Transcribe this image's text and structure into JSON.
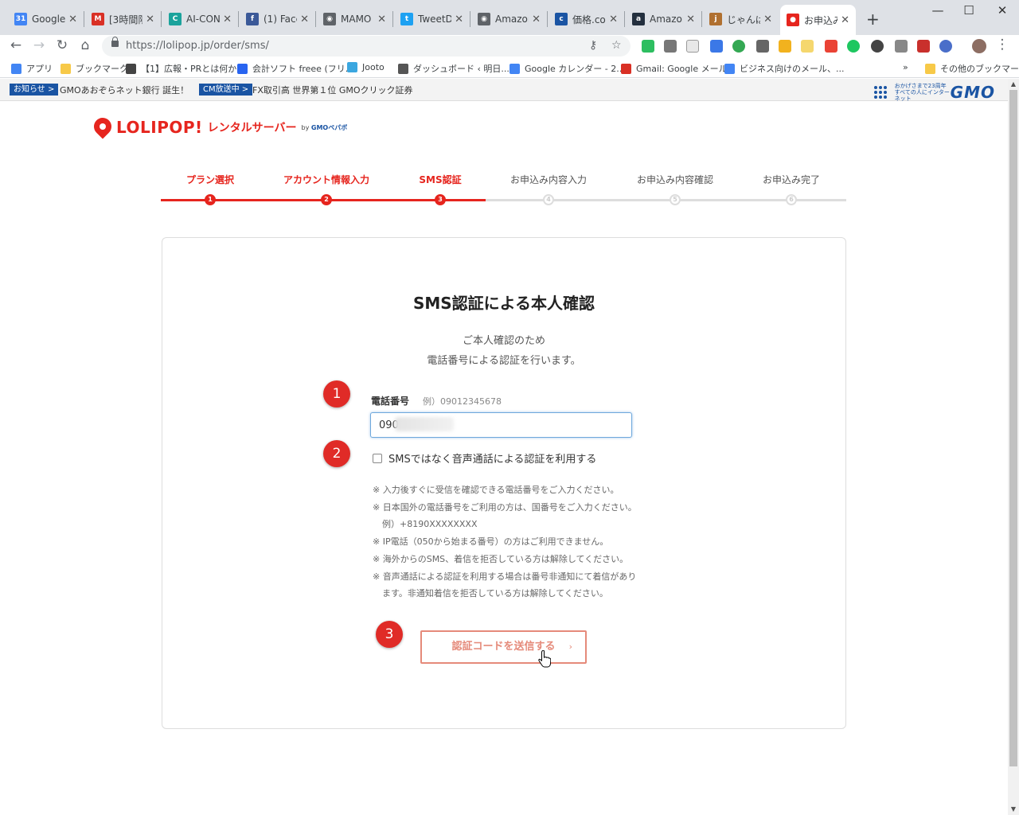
{
  "browser": {
    "tabs": [
      {
        "title": "Google",
        "favicon": "google-calendar-icon",
        "color": "#4285f4",
        "glyph": "31"
      },
      {
        "title": "[3時間限",
        "favicon": "gmail-icon",
        "color": "#d93025",
        "glyph": "M"
      },
      {
        "title": "AI-CON",
        "favicon": "ai-con-icon",
        "color": "#1ba39c",
        "glyph": "C"
      },
      {
        "title": "(1) Face",
        "favicon": "facebook-icon",
        "color": "#3b5998",
        "glyph": "f"
      },
      {
        "title": "MAMO",
        "favicon": "globe-icon",
        "color": "#5f6368",
        "glyph": "◉"
      },
      {
        "title": "TweetD",
        "favicon": "twitter-icon",
        "color": "#1da1f2",
        "glyph": "t"
      },
      {
        "title": "Amazon",
        "favicon": "globe-icon",
        "color": "#5f6368",
        "glyph": "◉"
      },
      {
        "title": "価格.co",
        "favicon": "kakaku-icon",
        "color": "#1a54a3",
        "glyph": "c"
      },
      {
        "title": "Amazon",
        "favicon": "amazon-icon",
        "color": "#232f3e",
        "glyph": "a"
      },
      {
        "title": "じゃんぱ",
        "favicon": "janpara-icon",
        "color": "#b07030",
        "glyph": "j"
      },
      {
        "title": "お申込み",
        "favicon": "lolipop-icon",
        "color": "#e6251e",
        "glyph": "●",
        "active": true
      }
    ],
    "url": "https://lolipop.jp/order/sms/",
    "bookmarks": [
      {
        "label": "アプリ",
        "icon": "apps-icon",
        "color": "#4285f4"
      },
      {
        "label": "ブックマーク",
        "icon": "folder-icon",
        "color": "#f7c948"
      },
      {
        "label": "【1】広報・PRとは何か...",
        "icon": "graduation-icon",
        "color": "#444"
      },
      {
        "label": "会計ソフト freee (フリ...",
        "icon": "freee-icon",
        "color": "#2864f0"
      },
      {
        "label": "Jooto",
        "icon": "jooto-icon",
        "color": "#3ba7e0"
      },
      {
        "label": "ダッシュボード ‹ 明日...",
        "icon": "wordpress-icon",
        "color": "#555"
      },
      {
        "label": "Google カレンダー - 2...",
        "icon": "google-calendar-icon",
        "color": "#4285f4"
      },
      {
        "label": "Gmail: Google メール",
        "icon": "gmail-icon",
        "color": "#d93025"
      },
      {
        "label": "ビジネス向けのメール、...",
        "icon": "google-icon",
        "color": "#4285f4"
      }
    ],
    "bookmarks_overflow": "»",
    "other_bookmarks": "その他のブックマーク"
  },
  "newsbar": {
    "badge1": "お知らせ >",
    "text1": "GMOあおぞらネット銀行 誕生！",
    "badge2": "CM放送中 >",
    "text2": "FX取引高 世界第１位 GMOクリック証券",
    "tagline1": "おかげさまで23周年",
    "tagline2": "すべての人にインターネット",
    "brand": "GMO",
    "accent": "#1a54a3"
  },
  "logo": {
    "name": "LOLIPOP!",
    "sub": "レンタルサーバー",
    "by": "by",
    "by_brand": "GMOペパボ",
    "color": "#e6251e"
  },
  "steps": {
    "items": [
      {
        "label": "プラン選択",
        "num": "1",
        "done": true
      },
      {
        "label": "アカウント情報入力",
        "num": "2",
        "done": true
      },
      {
        "label": "SMS認証",
        "num": "3",
        "done": true
      },
      {
        "label": "お申込み内容入力",
        "num": "4",
        "done": false
      },
      {
        "label": "お申込み内容確認",
        "num": "5",
        "done": false
      },
      {
        "label": "お申込み完了",
        "num": "6",
        "done": false
      }
    ]
  },
  "form": {
    "title": "SMS認証による本人確認",
    "desc_line1": "ご本人確認のため",
    "desc_line2": "電話番号による認証を行います。",
    "phone_label": "電話番号",
    "phone_example": "例）09012345678",
    "phone_value": "090",
    "voice_label": "SMSではなく音声通話による認証を利用する",
    "voice_checked": false,
    "notes": [
      {
        "text": "※ 入力後すぐに受信を確認できる電話番号をご入力ください。",
        "indent": false
      },
      {
        "text": "※ 日本国外の電話番号をご利用の方は、国番号をご入力ください。",
        "indent": false
      },
      {
        "text": "例）+8190XXXXXXXX",
        "indent": true
      },
      {
        "text": "※ IP電話（050から始まる番号）の方はご利用できません。",
        "indent": false
      },
      {
        "text": "※ 海外からのSMS、着信を拒否している方は解除してください。",
        "indent": false
      },
      {
        "text": "※ 音声通話による認証を利用する場合は番号非通知にて着信があり",
        "indent": false
      },
      {
        "text": "ます。非通知着信を拒否している方は解除してください。",
        "indent": true
      }
    ],
    "submit": "認証コードを送信する",
    "submit_chevron": "›"
  },
  "annotations": [
    "1",
    "2",
    "3"
  ]
}
